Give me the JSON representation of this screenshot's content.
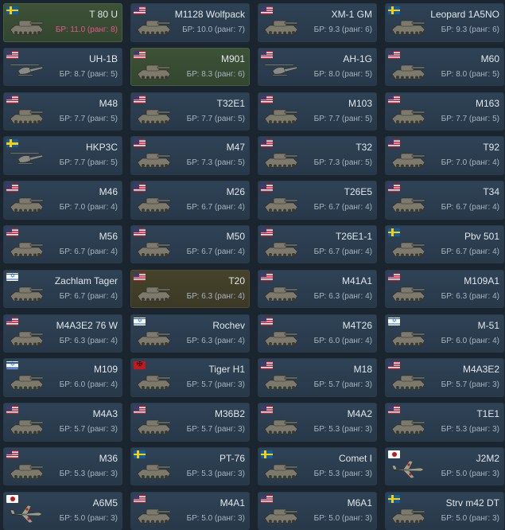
{
  "br_prefix": "БР:",
  "rank_word": "ранг",
  "colors": {
    "card": "#2f4356",
    "card_green": "#3d5237",
    "card_olive": "#46432b",
    "br_highlight": "#e5578a"
  },
  "vehicles": [
    {
      "name": "T 80 U",
      "br": "11.0",
      "rank": "8",
      "flag": "sweden",
      "type": "tank",
      "bg": "green",
      "highlight": true
    },
    {
      "name": "M1128 Wolfpack",
      "br": "10.0",
      "rank": "7",
      "flag": "usa",
      "type": "tank",
      "bg": "default",
      "highlight": false
    },
    {
      "name": "XM-1 GM",
      "br": "9.3",
      "rank": "6",
      "flag": "usa",
      "type": "tank",
      "bg": "default",
      "highlight": false
    },
    {
      "name": "Leopard 1A5NO",
      "br": "9.3",
      "rank": "6",
      "flag": "sweden",
      "type": "tank",
      "bg": "default",
      "highlight": false
    },
    {
      "name": "UH-1B",
      "br": "8.7",
      "rank": "5",
      "flag": "usa",
      "type": "heli",
      "bg": "default",
      "highlight": false
    },
    {
      "name": "M901",
      "br": "8.3",
      "rank": "6",
      "flag": "usa",
      "type": "tank",
      "bg": "green",
      "highlight": false
    },
    {
      "name": "AH-1G",
      "br": "8.0",
      "rank": "5",
      "flag": "usa",
      "type": "heli",
      "bg": "default",
      "highlight": false
    },
    {
      "name": "M60",
      "br": "8.0",
      "rank": "5",
      "flag": "usa",
      "type": "tank",
      "bg": "default",
      "highlight": false
    },
    {
      "name": "M48",
      "br": "7.7",
      "rank": "5",
      "flag": "usa",
      "type": "tank",
      "bg": "default",
      "highlight": false
    },
    {
      "name": "T32E1",
      "br": "7.7",
      "rank": "5",
      "flag": "usa",
      "type": "tank",
      "bg": "default",
      "highlight": false
    },
    {
      "name": "M103",
      "br": "7.7",
      "rank": "5",
      "flag": "usa",
      "type": "tank",
      "bg": "default",
      "highlight": false
    },
    {
      "name": "M163",
      "br": "7.7",
      "rank": "5",
      "flag": "usa",
      "type": "tank",
      "bg": "default",
      "highlight": false
    },
    {
      "name": "HKP3C",
      "br": "7.7",
      "rank": "5",
      "flag": "sweden",
      "type": "heli",
      "bg": "default",
      "highlight": false
    },
    {
      "name": "M47",
      "br": "7.3",
      "rank": "5",
      "flag": "usa",
      "type": "tank",
      "bg": "default",
      "highlight": false
    },
    {
      "name": "T32",
      "br": "7.3",
      "rank": "5",
      "flag": "usa",
      "type": "tank",
      "bg": "default",
      "highlight": false
    },
    {
      "name": "T92",
      "br": "7.0",
      "rank": "4",
      "flag": "usa",
      "type": "tank",
      "bg": "default",
      "highlight": false
    },
    {
      "name": "M46",
      "br": "7.0",
      "rank": "4",
      "flag": "usa",
      "type": "tank",
      "bg": "default",
      "highlight": false
    },
    {
      "name": "M26",
      "br": "6.7",
      "rank": "4",
      "flag": "usa",
      "type": "tank",
      "bg": "default",
      "highlight": false
    },
    {
      "name": "T26E5",
      "br": "6.7",
      "rank": "4",
      "flag": "usa",
      "type": "tank",
      "bg": "default",
      "highlight": false
    },
    {
      "name": "T34",
      "br": "6.7",
      "rank": "4",
      "flag": "usa",
      "type": "tank",
      "bg": "default",
      "highlight": false
    },
    {
      "name": "M56",
      "br": "6.7",
      "rank": "4",
      "flag": "usa",
      "type": "tank",
      "bg": "default",
      "highlight": false
    },
    {
      "name": "M50",
      "br": "6.7",
      "rank": "4",
      "flag": "usa",
      "type": "tank",
      "bg": "default",
      "highlight": false
    },
    {
      "name": "T26E1-1",
      "br": "6.7",
      "rank": "4",
      "flag": "usa",
      "type": "tank",
      "bg": "default",
      "highlight": false
    },
    {
      "name": "Pbv 501",
      "br": "6.7",
      "rank": "4",
      "flag": "sweden",
      "type": "tank",
      "bg": "default",
      "highlight": false
    },
    {
      "name": "Zachlam Tager",
      "br": "6.7",
      "rank": "4",
      "flag": "israel",
      "type": "tank",
      "bg": "default",
      "highlight": false
    },
    {
      "name": "T20",
      "br": "6.3",
      "rank": "4",
      "flag": "usa",
      "type": "tank",
      "bg": "olive",
      "highlight": false
    },
    {
      "name": "M41A1",
      "br": "6.3",
      "rank": "4",
      "flag": "usa",
      "type": "tank",
      "bg": "default",
      "highlight": false
    },
    {
      "name": "M109A1",
      "br": "6.3",
      "rank": "4",
      "flag": "usa",
      "type": "tank",
      "bg": "default",
      "highlight": false
    },
    {
      "name": "M4A3E2 76 W",
      "br": "6.3",
      "rank": "4",
      "flag": "usa",
      "type": "tank",
      "bg": "default",
      "highlight": false
    },
    {
      "name": "Rochev",
      "br": "6.3",
      "rank": "4",
      "flag": "israel",
      "type": "tank",
      "bg": "default",
      "highlight": false
    },
    {
      "name": "M4T26",
      "br": "6.0",
      "rank": "4",
      "flag": "usa",
      "type": "tank",
      "bg": "default",
      "highlight": false
    },
    {
      "name": "M-51",
      "br": "6.0",
      "rank": "4",
      "flag": "israel",
      "type": "tank",
      "bg": "default",
      "highlight": false
    },
    {
      "name": "M109",
      "br": "6.0",
      "rank": "4",
      "flag": "israel",
      "type": "tank",
      "bg": "default",
      "highlight": false
    },
    {
      "name": "Tiger H1",
      "br": "5.7",
      "rank": "3",
      "flag": "germany",
      "type": "tank",
      "bg": "default",
      "highlight": false
    },
    {
      "name": "M18",
      "br": "5.7",
      "rank": "3",
      "flag": "usa",
      "type": "tank",
      "bg": "default",
      "highlight": false
    },
    {
      "name": "M4A3E2",
      "br": "5.7",
      "rank": "3",
      "flag": "usa",
      "type": "tank",
      "bg": "default",
      "highlight": false
    },
    {
      "name": "M4A3",
      "br": "5.7",
      "rank": "3",
      "flag": "usa",
      "type": "tank",
      "bg": "default",
      "highlight": false
    },
    {
      "name": "M36B2",
      "br": "5.7",
      "rank": "3",
      "flag": "usa",
      "type": "tank",
      "bg": "default",
      "highlight": false
    },
    {
      "name": "M4A2",
      "br": "5.3",
      "rank": "3",
      "flag": "usa",
      "type": "tank",
      "bg": "default",
      "highlight": false
    },
    {
      "name": "T1E1",
      "br": "5.3",
      "rank": "3",
      "flag": "usa",
      "type": "tank",
      "bg": "default",
      "highlight": false
    },
    {
      "name": "M36",
      "br": "5.3",
      "rank": "3",
      "flag": "usa",
      "type": "tank",
      "bg": "default",
      "highlight": false
    },
    {
      "name": "PT-76",
      "br": "5.3",
      "rank": "3",
      "flag": "sweden",
      "type": "tank",
      "bg": "default",
      "highlight": false
    },
    {
      "name": "Comet I",
      "br": "5.3",
      "rank": "3",
      "flag": "sweden",
      "type": "tank",
      "bg": "default",
      "highlight": false
    },
    {
      "name": "J2M2",
      "br": "5.0",
      "rank": "3",
      "flag": "japan",
      "type": "plane",
      "bg": "default",
      "highlight": false
    },
    {
      "name": "A6M5",
      "br": "5.0",
      "rank": "3",
      "flag": "japan",
      "type": "plane",
      "bg": "default",
      "highlight": false
    },
    {
      "name": "M4A1",
      "br": "5.0",
      "rank": "3",
      "flag": "usa",
      "type": "tank",
      "bg": "default",
      "highlight": false
    },
    {
      "name": "M6A1",
      "br": "5.0",
      "rank": "3",
      "flag": "usa",
      "type": "tank",
      "bg": "default",
      "highlight": false
    },
    {
      "name": "Strv m42 DT",
      "br": "5.0",
      "rank": "3",
      "flag": "sweden",
      "type": "tank",
      "bg": "default",
      "highlight": false
    }
  ]
}
